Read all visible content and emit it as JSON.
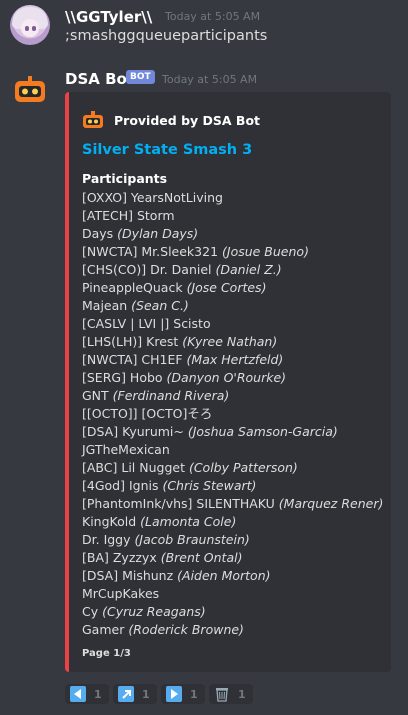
{
  "messages": [
    {
      "username": "\\\\GGTyler\\\\",
      "timestamp": "Today at 5:05 AM",
      "content": ";smashggqueueparticipants"
    },
    {
      "username": "DSA Bot",
      "bot_tag": "BOT",
      "timestamp": "Today at 5:05 AM",
      "embed": {
        "accent_color": "#ed4245",
        "author": "Provided by DSA Bot",
        "title": "Silver State Smash 3",
        "field_name": "Participants",
        "participants": [
          {
            "tag": "[OXXO] YearsNotLiving",
            "name": ""
          },
          {
            "tag": "[ATECH] Storm",
            "name": ""
          },
          {
            "tag": "Days ",
            "name": "(Dylan Days)"
          },
          {
            "tag": "[NWCTA] Mr.Sleek321 ",
            "name": "(Josue Bueno)"
          },
          {
            "tag": "[CHS(CO)] Dr. Daniel ",
            "name": "(Daniel Z.)"
          },
          {
            "tag": "PineappleQuack ",
            "name": "(Jose Cortes)"
          },
          {
            "tag": "Majean ",
            "name": "(Sean C.)"
          },
          {
            "tag": "[CASLV | LVI |] Scisto",
            "name": ""
          },
          {
            "tag": "[LHS(LH)] Krest ",
            "name": "(Kyree Nathan)"
          },
          {
            "tag": "[NWCTA] CH1EF ",
            "name": "(Max Hertzfeld)"
          },
          {
            "tag": "[SERG] Hobo ",
            "name": "(Danyon O'Rourke)"
          },
          {
            "tag": "GNT ",
            "name": "(Ferdinand Rivera)"
          },
          {
            "tag": "[[OCTO]] [OCTO]そろ",
            "name": ""
          },
          {
            "tag": "[DSA] Kyurumi~ ",
            "name": "(Joshua Samson-Garcia)"
          },
          {
            "tag": "JGTheMexican",
            "name": ""
          },
          {
            "tag": "[ABC] Lil Nugget ",
            "name": "(Colby Patterson)"
          },
          {
            "tag": "[4God] Ignis ",
            "name": "(Chris Stewart)"
          },
          {
            "tag": "[PhantomInk/vhs] SILENTHAKU ",
            "name": "(Marquez Rener)"
          },
          {
            "tag": "KingKold ",
            "name": "(Lamonta Cole)"
          },
          {
            "tag": "Dr. Iggy ",
            "name": "(Jacob Braunstein)"
          },
          {
            "tag": "[BA] Zyzzyx ",
            "name": "(Brent Ontal)"
          },
          {
            "tag": "[DSA] Mishunz ",
            "name": "(Aiden Morton)"
          },
          {
            "tag": "MrCupKakes",
            "name": ""
          },
          {
            "tag": "Cy ",
            "name": "(Cyruz Reagans)"
          },
          {
            "tag": "Gamer ",
            "name": "(Roderick Browne)"
          }
        ],
        "footer": "Page 1/3"
      },
      "reactions": [
        {
          "icon": "arrow-backward-icon",
          "count": "1"
        },
        {
          "icon": "arrow-upper-right-icon",
          "count": "1"
        },
        {
          "icon": "arrow-forward-icon",
          "count": "1"
        },
        {
          "icon": "wastebasket-icon",
          "count": "1"
        }
      ]
    }
  ]
}
